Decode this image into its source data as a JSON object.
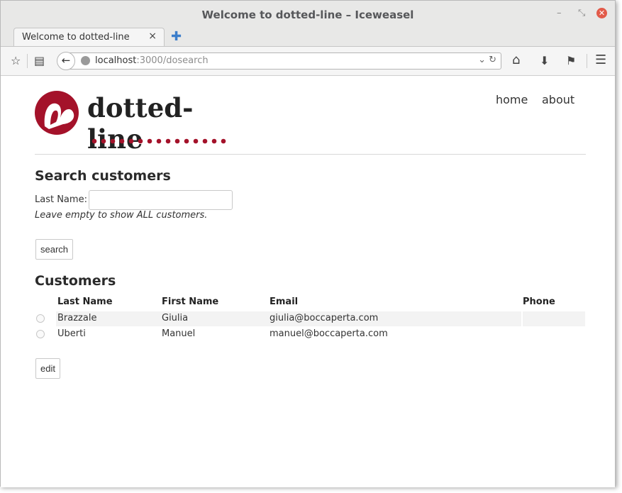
{
  "window": {
    "title": "Welcome to dotted-line – Iceweasel",
    "min_glyph": "–",
    "max_glyph": "⤡",
    "close_glyph": "✕"
  },
  "tabs": [
    {
      "label": "Welcome to dotted-line",
      "close_glyph": "×"
    }
  ],
  "newtab_glyph": "✚",
  "navbar": {
    "bookmark_star": "☆",
    "reader_icon": "▤",
    "back_glyph": "←",
    "url_host": "localhost",
    "url_path": ":3000/dosearch",
    "url_dropdown": "⌄ ↻",
    "home_icon": "⌂",
    "download_icon": "⬇",
    "flag_icon": "⚑",
    "menu_icon": "☰"
  },
  "site": {
    "brand": "dotted-line",
    "brand_color": "#a4122a",
    "nav": [
      {
        "label": "home"
      },
      {
        "label": "about"
      }
    ]
  },
  "search": {
    "heading": "Search customers",
    "last_name_label": "Last Name:",
    "last_name_value": "",
    "hint": "Leave empty to show ALL customers.",
    "button_label": "search"
  },
  "customers": {
    "heading": "Customers",
    "columns": [
      "Last Name",
      "First Name",
      "Email",
      "Phone"
    ],
    "rows": [
      {
        "last": "Brazzale",
        "first": "Giulia",
        "email": "giulia@boccaperta.com",
        "phone": ""
      },
      {
        "last": "Uberti",
        "first": "Manuel",
        "email": "manuel@boccaperta.com",
        "phone": ""
      }
    ],
    "edit_label": "edit"
  }
}
